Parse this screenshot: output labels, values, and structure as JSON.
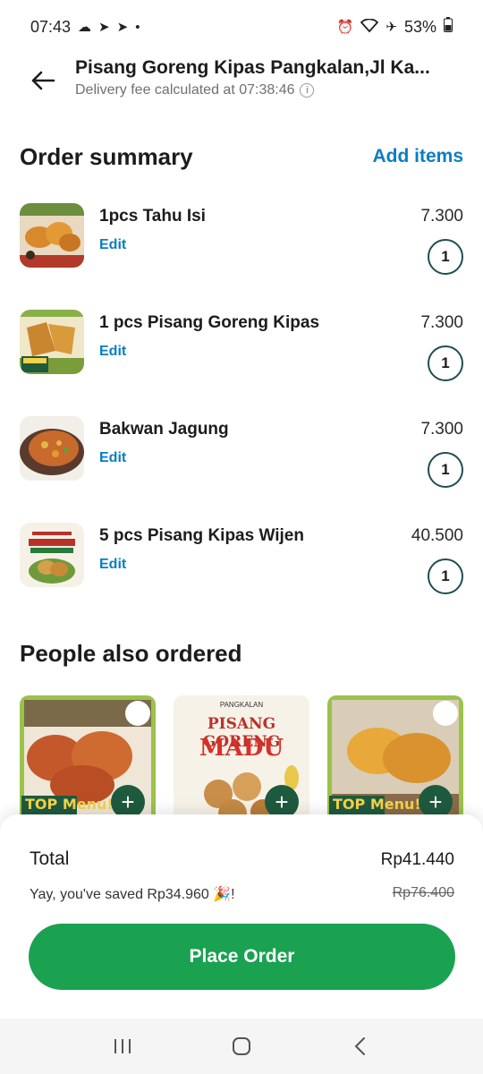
{
  "status_bar": {
    "time": "07:43",
    "battery": "53%"
  },
  "header": {
    "store_name": "Pisang Goreng Kipas Pangkalan,Jl Ka...",
    "fee_note": "Delivery fee calculated at 07:38:46"
  },
  "order_summary": {
    "title": "Order summary",
    "add_items_label": "Add items",
    "items": [
      {
        "name": "1pcs Tahu Isi",
        "edit_label": "Edit",
        "price": "7.300",
        "quantity": "1"
      },
      {
        "name": "1 pcs Pisang Goreng Kipas",
        "edit_label": "Edit",
        "price": "7.300",
        "quantity": "1"
      },
      {
        "name": "Bakwan Jagung",
        "edit_label": "Edit",
        "price": "7.300",
        "quantity": "1"
      },
      {
        "name": "5 pcs Pisang Kipas Wijen",
        "edit_label": "Edit",
        "price": "40.500",
        "quantity": "1"
      }
    ]
  },
  "people_also_ordered": {
    "title": "People also ordered",
    "cards": [
      {
        "badge": "TOP Menu!"
      },
      {
        "top_text": "PANGKALAN",
        "title_line1": "PISANG GORENG",
        "title_line2": "MADU"
      },
      {
        "badge": "TOP Menu!"
      }
    ]
  },
  "checkout": {
    "total_label": "Total",
    "total_value": "Rp41.440",
    "saved_text": "Yay, you've saved Rp34.960 🎉!",
    "original_price": "Rp76.400",
    "place_order_label": "Place Order"
  },
  "colors": {
    "accent_blue": "#0a7ec2",
    "primary_green": "#1aa251",
    "qty_border": "#1e4e52"
  }
}
